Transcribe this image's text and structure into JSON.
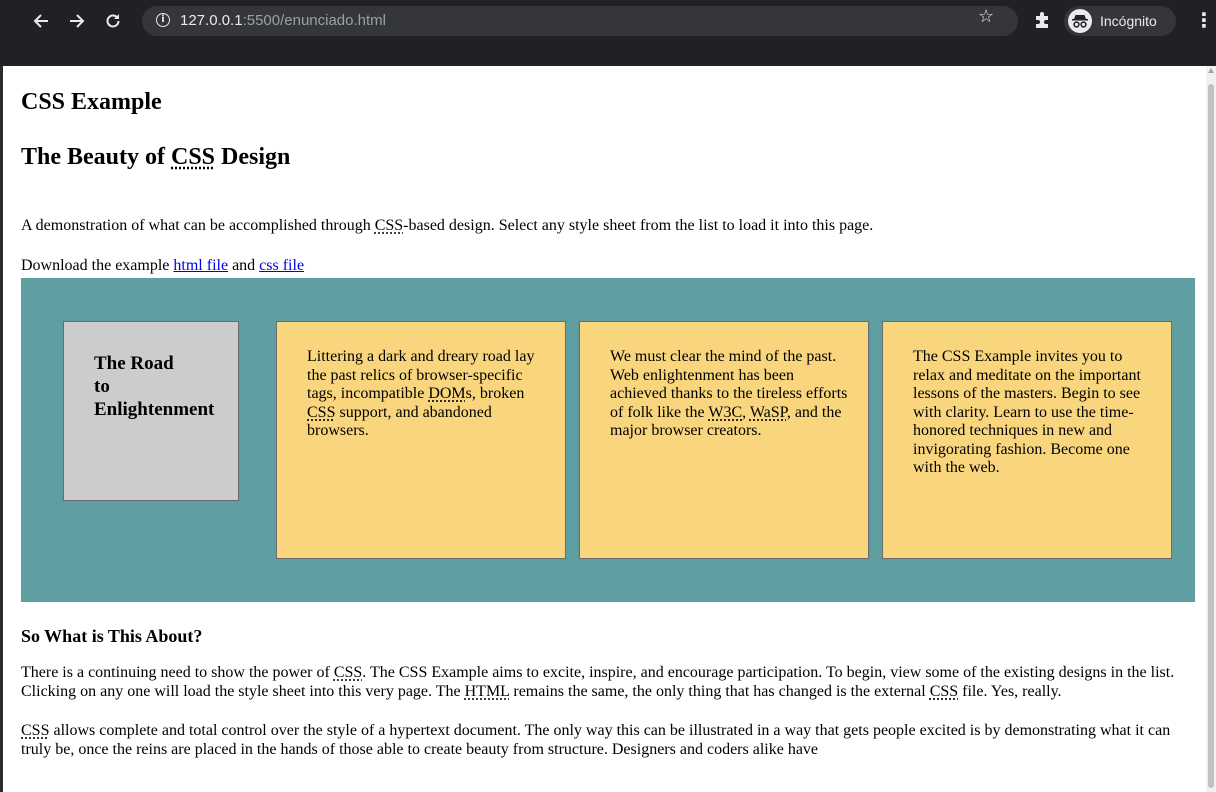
{
  "browser": {
    "url_host": "127.0.0.1",
    "url_rest": ":5500/enunciado.html",
    "incognito_label": "Incógnito"
  },
  "page": {
    "title": "CSS Example",
    "subtitle_pre": "The Beauty of ",
    "subtitle_abbr": "CSS",
    "subtitle_post": " Design",
    "intro_abbr": "CSS",
    "intro_pre": "A demonstration of what can be accomplished through ",
    "intro_post": "-based design. Select any style sheet from the list to load it into this page.",
    "download_pre": "Download the example ",
    "download_html_link": "html file",
    "download_and": " and ",
    "download_css_link": "css file"
  },
  "panel": {
    "title_lines": [
      "The Road",
      "to",
      "Enlightenment"
    ],
    "card1_a": "Littering a dark and dreary road lay the past relics of browser-specific tags, incompatible ",
    "card1_abbr1": "DOM",
    "card1_b": "s, broken ",
    "card1_abbr2": "CSS",
    "card1_c": " support, and abandoned browsers.",
    "card2_a": "We must clear the mind of the past. Web enlightenment has been achieved thanks to the tireless efforts of folk like the ",
    "card2_abbr1": "W3C",
    "card2_b": ", ",
    "card2_abbr2": "WaSP",
    "card2_c": ", and the major browser creators.",
    "card3_text": "The CSS Example invites you to relax and meditate on the important lessons of the masters. Begin to see with clarity. Learn to use the time-honored techniques in new and invigorating fashion. Become one with the web."
  },
  "about": {
    "heading": "So What is This About?",
    "p1_a": "There is a continuing need to show the power of ",
    "p1_abbr1": "CSS",
    "p1_b": ". The CSS Example aims to excite, inspire, and encourage participation. To begin, view some of the existing designs in the list. Clicking on any one will load the style sheet into this very page. The ",
    "p1_abbr2": "HTML",
    "p1_c": " remains the same, the only thing that has changed is the external ",
    "p1_abbr3": "CSS",
    "p1_d": " file. Yes, really.",
    "p2_abbr": "CSS",
    "p2_text": " allows complete and total control over the style of a hypertext document. The only way this can be illustrated in a way that gets people excited is by demonstrating what it can truly be, once the reins are placed in the hands of those able to create beauty from structure. Designers and coders alike have"
  },
  "icons": {
    "back": "back-arrow-icon",
    "forward": "forward-arrow-icon",
    "reload": "reload-icon",
    "info": "info-icon",
    "star": "star-icon",
    "extensions": "puzzle-piece-icon",
    "incognito": "incognito-icon",
    "menu": "kebab-menu-icon"
  }
}
